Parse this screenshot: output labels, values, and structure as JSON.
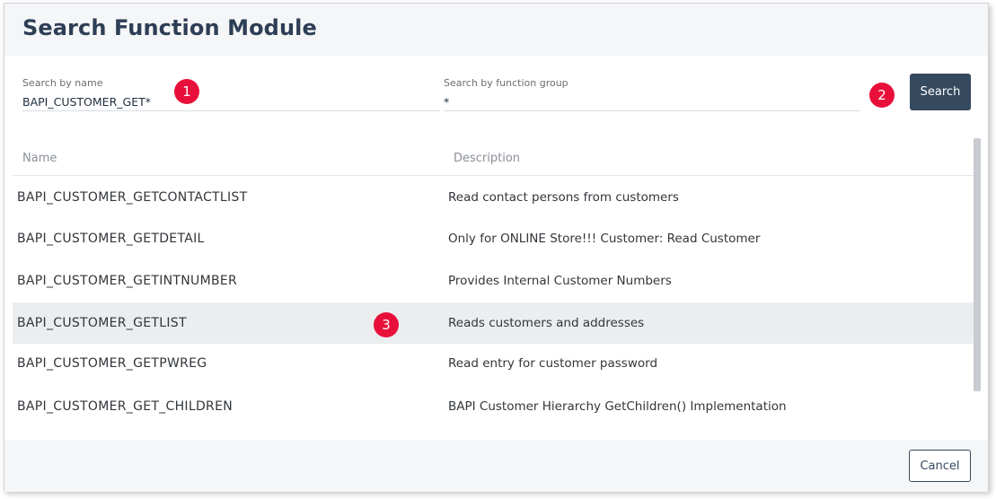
{
  "dialog": {
    "title": "Search Function Module"
  },
  "search": {
    "name_label": "Search by name",
    "name_value": "BAPI_CUSTOMER_GET*",
    "group_label": "Search by function group",
    "group_value": "*",
    "button_label": "Search"
  },
  "markers": [
    "1",
    "2",
    "3"
  ],
  "table": {
    "columns": [
      "Name",
      "Description"
    ],
    "rows": [
      {
        "name": "BAPI_CUSTOMER_GETCONTACTLIST",
        "description": "Read contact persons from customers",
        "selected": false
      },
      {
        "name": "BAPI_CUSTOMER_GETDETAIL",
        "description": "Only for ONLINE Store!!! Customer: Read Customer",
        "selected": false
      },
      {
        "name": "BAPI_CUSTOMER_GETINTNUMBER",
        "description": "Provides Internal Customer Numbers",
        "selected": false
      },
      {
        "name": "BAPI_CUSTOMER_GETLIST",
        "description": "Reads customers and addresses",
        "selected": true
      },
      {
        "name": "BAPI_CUSTOMER_GETPWREG",
        "description": "Read entry for customer password",
        "selected": false
      },
      {
        "name": "BAPI_CUSTOMER_GET_CHILDREN",
        "description": "BAPI Customer Hierarchy GetChildren() Implementation",
        "selected": false
      }
    ]
  },
  "footer": {
    "cancel_label": "Cancel"
  },
  "colors": {
    "primary": "#354a5f",
    "marker": "#e8103a",
    "title": "#2d3e55",
    "selected_row": "#ebedef"
  }
}
